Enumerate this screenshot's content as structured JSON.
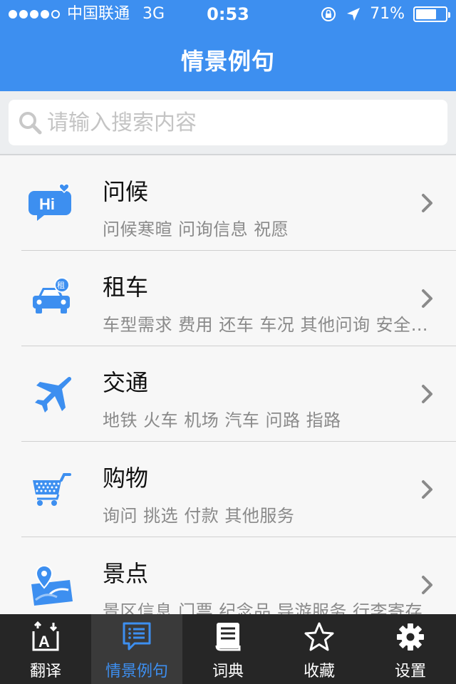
{
  "status_bar": {
    "carrier": "中国联通",
    "network": "3G",
    "time": "0:53",
    "battery": "71%",
    "battery_level": 0.71
  },
  "nav": {
    "title": "情景例句"
  },
  "search": {
    "placeholder": "请输入搜索内容",
    "value": ""
  },
  "list": [
    {
      "title": "问候",
      "subtitle": "问候寒暄 问询信息 祝愿",
      "icon": "hi-chat-icon"
    },
    {
      "title": "租车",
      "subtitle": "车型需求 费用 还车 车况 其他问询 安全须知",
      "icon": "car-rental-icon"
    },
    {
      "title": "交通",
      "subtitle": "地铁 火车 机场 汽车 问路 指路",
      "icon": "airplane-icon"
    },
    {
      "title": "购物",
      "subtitle": "询问 挑选 付款 其他服务",
      "icon": "shopping-cart-icon"
    },
    {
      "title": "景点",
      "subtitle": "景区信息 门票 纪念品 导游服务 行李寄存",
      "icon": "map-location-icon"
    }
  ],
  "tabs": [
    {
      "label": "翻译",
      "icon": "translate-icon"
    },
    {
      "label": "情景例句",
      "icon": "scene-phrases-icon",
      "active": true
    },
    {
      "label": "词典",
      "icon": "dictionary-icon"
    },
    {
      "label": "收藏",
      "icon": "star-icon"
    },
    {
      "label": "设置",
      "icon": "gear-icon"
    }
  ],
  "colors": {
    "primary": "#3d8ff0",
    "tabbar_bg": "#262626",
    "tab_active_bg": "#3a3a3a",
    "subtitle": "#8a8a8a"
  }
}
